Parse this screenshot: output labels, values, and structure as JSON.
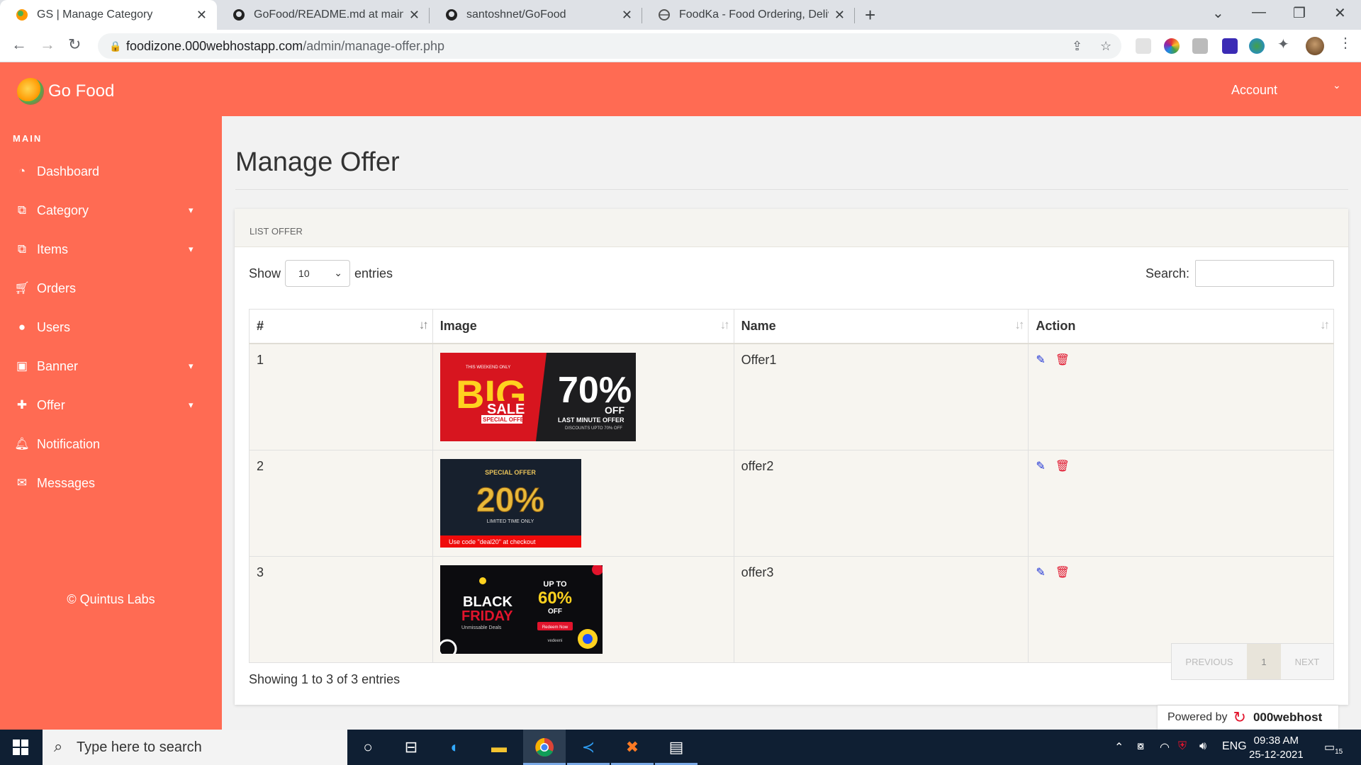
{
  "browser": {
    "tabs": [
      {
        "title": "GS | Manage Category",
        "active": true
      },
      {
        "title": "GoFood/README.md at main · sa",
        "active": false
      },
      {
        "title": "santoshnet/GoFood",
        "active": false
      },
      {
        "title": "FoodKa - Food Ordering, Deliver",
        "active": false
      }
    ],
    "url_host": "foodizone.000webhostapp.com",
    "url_path": "/admin/manage-offer.php"
  },
  "app": {
    "brand": "Go Food",
    "account_label": "Account",
    "accent_color": "#ff6b53"
  },
  "sidebar": {
    "section": "MAIN",
    "items": [
      {
        "label": "Dashboard",
        "icon": "dashboard-icon",
        "chevron": false
      },
      {
        "label": "Category",
        "icon": "category-icon",
        "chevron": true
      },
      {
        "label": "Items",
        "icon": "items-icon",
        "chevron": true
      },
      {
        "label": "Orders",
        "icon": "cart-icon",
        "chevron": false
      },
      {
        "label": "Users",
        "icon": "user-icon",
        "chevron": false
      },
      {
        "label": "Banner",
        "icon": "image-icon",
        "chevron": true
      },
      {
        "label": "Offer",
        "icon": "gift-icon",
        "chevron": true
      },
      {
        "label": "Notification",
        "icon": "bell-icon",
        "chevron": false
      },
      {
        "label": "Messages",
        "icon": "envelope-icon",
        "chevron": false
      }
    ],
    "footer": "© Quintus Labs"
  },
  "main": {
    "title": "Manage Offer",
    "card_title": "LIST OFFER",
    "show_label": "Show",
    "entries_label": "entries",
    "page_size": "10",
    "search_label": "Search:",
    "search_value": "",
    "columns": [
      "#",
      "Image",
      "Name",
      "Action"
    ],
    "rows": [
      {
        "no": "1",
        "name": "Offer1",
        "image": {
          "pre": "THIS WEEKEND ONLY",
          "big": "BIG",
          "sale": "SALE",
          "tag": "SPECIAL OFFER",
          "pct": "70%",
          "off": "OFF",
          "line": "LAST MINUTE OFFER",
          "sub": "DISCOUNTS UPTO 70% OFF"
        }
      },
      {
        "no": "2",
        "name": "offer2",
        "image": {
          "pre": "SPECIAL OFFER",
          "pct": "20%",
          "sub": "LIMITED TIME ONLY",
          "code": "Use code \"deal20\" at checkout"
        }
      },
      {
        "no": "3",
        "name": "offer3",
        "image": {
          "big": "BLACK",
          "friday": "FRIDAY",
          "sub": "Unmissable Deals",
          "upto": "UP TO",
          "pct": "60%",
          "off": "OFF",
          "btn": "Redeem Now",
          "brand": "vedeeni"
        }
      }
    ],
    "info": "Showing 1 to 3 of 3 entries",
    "pager": {
      "prev": "PREVIOUS",
      "page": "1",
      "next": "NEXT"
    }
  },
  "powered": {
    "label": "Powered by",
    "host": "000webhost"
  },
  "taskbar": {
    "search_placeholder": "Type here to search",
    "lang": "ENG",
    "time": "09:38 AM",
    "date": "25-12-2021",
    "notif_count": "15"
  }
}
